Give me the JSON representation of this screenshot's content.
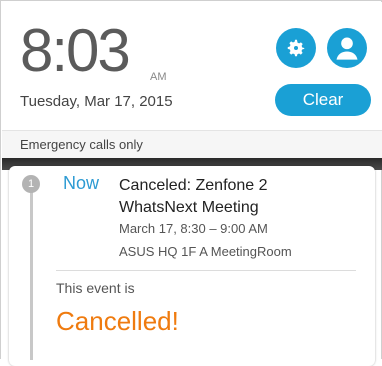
{
  "lockscreen": {
    "time": "8:03",
    "ampm": "AM",
    "date": "Tuesday, Mar 17, 2015",
    "clear_label": "Clear",
    "settings_icon": "gear-icon",
    "user_icon": "user-avatar-icon",
    "accent_color": "#1aa0d5"
  },
  "status": {
    "emergency": "Emergency calls only"
  },
  "notification": {
    "index": "1",
    "now_label": "Now",
    "title": "Canceled: Zenfone 2 WhatsNext Meeting",
    "time_range": "March 17, 8:30 – 9:00 AM",
    "location": "ASUS HQ 1F A MeetingRoom",
    "event_prefix": "This event is",
    "event_status": "Cancelled!",
    "status_color": "#ef7b0f"
  }
}
